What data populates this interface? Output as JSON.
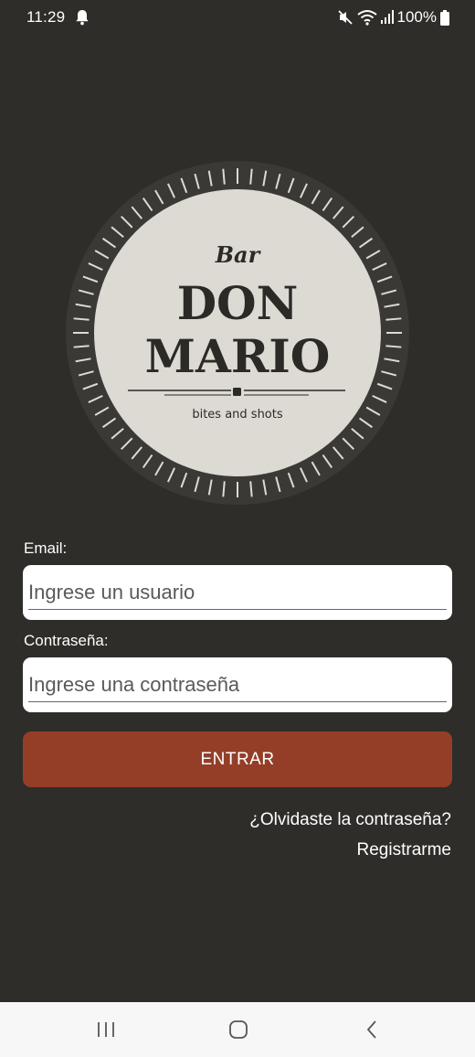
{
  "status_bar": {
    "time": "11:29",
    "battery": "100%",
    "icons": [
      "bell-icon",
      "mute-icon",
      "wifi-icon",
      "signal-icon",
      "battery-icon"
    ]
  },
  "logo": {
    "small_text": "Bar",
    "line1": "DON",
    "line2": "MARIO",
    "tagline": "bites and shots"
  },
  "form": {
    "email_label": "Email:",
    "email_placeholder": "Ingrese un usuario",
    "email_value": "",
    "password_label": "Contraseña:",
    "password_placeholder": "Ingrese una contraseña",
    "password_value": "",
    "submit_label": "ENTRAR"
  },
  "links": {
    "forgot_password": "¿Olvidaste la contraseña?",
    "register": "Registrarme"
  },
  "nav": {
    "icons": [
      "recent-apps-icon",
      "home-icon",
      "back-icon"
    ]
  },
  "colors": {
    "background": "#2e2d2a",
    "accent": "#943e27",
    "logo_face": "#dcdad3",
    "logo_text": "#2b2a26"
  }
}
